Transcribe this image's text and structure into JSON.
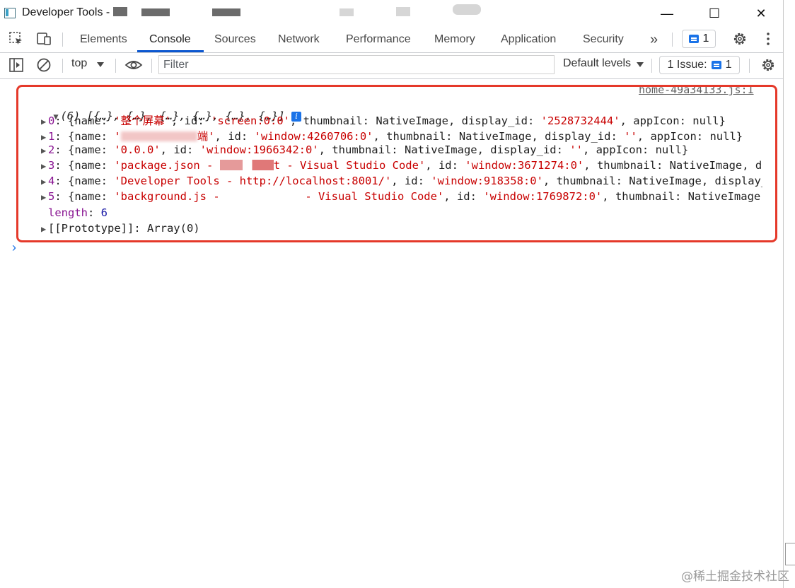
{
  "window": {
    "title": "Developer Tools -",
    "controls": {
      "minimize": "—",
      "maximize": "☐",
      "close": "✕"
    }
  },
  "tabs": [
    {
      "label": "Elements",
      "active": false
    },
    {
      "label": "Console",
      "active": true
    },
    {
      "label": "Sources",
      "active": false
    },
    {
      "label": "Network",
      "active": false
    },
    {
      "label": "Performance",
      "active": false
    },
    {
      "label": "Memory",
      "active": false
    },
    {
      "label": "Application",
      "active": false
    },
    {
      "label": "Security",
      "active": false
    }
  ],
  "tabs_more": "»",
  "messages_count": "1",
  "console_toolbar": {
    "context": "top",
    "filter_placeholder": "Filter",
    "levels": "Default levels",
    "issues_label": "1 Issue:",
    "issues_count": "1"
  },
  "console": {
    "source_link": "home-49a34133.js:1",
    "summary": "(6) [{…}, {…}, {…}, {…}, {…}, {…}]",
    "items": [
      {
        "index": "0",
        "name": "'整个屏幕'",
        "id": "'screen:0:0'",
        "display_id": "'2528732444'",
        "tail": ", appIcon: null}"
      },
      {
        "index": "1",
        "name": "'",
        "name_end": "端'",
        "id": "'window:4260706:0'",
        "display_id": "''",
        "tail": ", appIcon: null}"
      },
      {
        "index": "2",
        "name": "'0.0.0'",
        "id": "'window:1966342:0'",
        "display_id": "''",
        "tail": ", appIcon: null}"
      },
      {
        "index": "3",
        "name": "'package.json - ",
        "name_end": "t - Visual Studio Code'",
        "id": "'window:3671274:0'",
        "tail_cut": "thumbnail: NativeImage, d"
      },
      {
        "index": "4",
        "name": "'Developer Tools - http://localhost:8001/'",
        "id": "'window:918358:0'",
        "tail_cut": "thumbnail: NativeImage, display_i"
      },
      {
        "index": "5",
        "name": "'background.js - ",
        "name_end": " - Visual Studio Code'",
        "id": "'window:1769872:0'",
        "tail_cut": "thumbnail: NativeImage, d"
      }
    ],
    "length_key": "length",
    "length_value": "6",
    "prototype": "[[Prototype]]: Array(0)"
  },
  "watermark": "@稀土掘金技术社区",
  "colors": {
    "accent": "#1a73e8",
    "string": "#c80000",
    "key": "#881391",
    "highlight_border": "#e5392a"
  }
}
